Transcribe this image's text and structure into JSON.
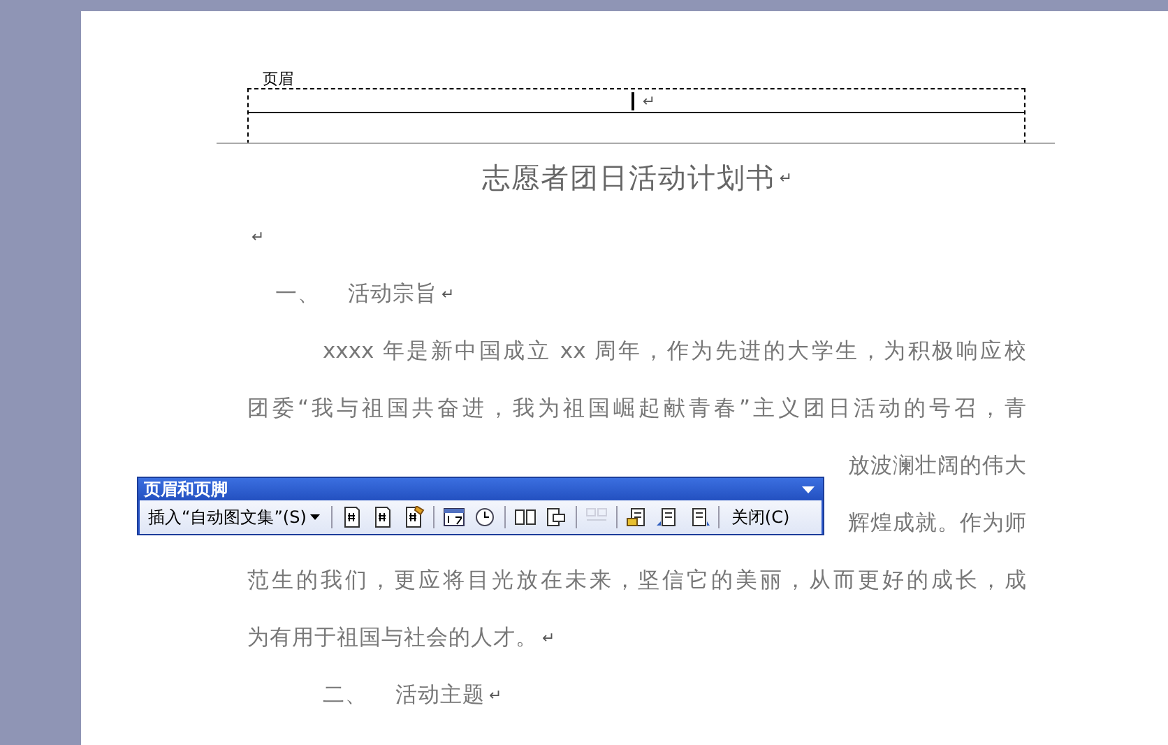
{
  "header": {
    "label": "页眉",
    "mark": "↵"
  },
  "title": {
    "text": "志愿者团日活动计划书",
    "mark": "↵"
  },
  "lines": [
    {
      "kind": "blank",
      "mark": "↵"
    },
    {
      "kind": "heading",
      "number": "一、",
      "text": "活动宗旨",
      "mark": "↵"
    },
    {
      "kind": "first_line",
      "text": "xxxx 年是新中国成立 xx 周年，作为先进的大学生，为积极响应校"
    },
    {
      "kind": "line",
      "text": "团委“我与祖国共奋进，我为祖国崛起献青春”主义团日活动的号召，青"
    },
    {
      "kind": "partial_line",
      "text": "放波澜壮阔的伟大"
    },
    {
      "kind": "partial_line",
      "text": "辉煌成就。作为师"
    },
    {
      "kind": "line",
      "text": "范生的我们，更应将目光放在未来，坚信它的美丽，从而更好的成长，成"
    },
    {
      "kind": "last_line",
      "text": "为有用于祖国与社会的人才。",
      "mark": "↵"
    },
    {
      "kind": "heading_indent",
      "number": "二、",
      "text": "活动主题",
      "mark": "↵"
    }
  ],
  "toolbar": {
    "title": "页眉和页脚",
    "items": [
      {
        "kind": "menu",
        "label": "插入“自动图文集”(S)"
      },
      {
        "kind": "sep"
      },
      {
        "kind": "icon",
        "disabled": false
      },
      {
        "kind": "icon",
        "disabled": false
      },
      {
        "kind": "icon",
        "disabled": false
      },
      {
        "kind": "sep"
      },
      {
        "kind": "icon",
        "disabled": false
      },
      {
        "kind": "icon",
        "disabled": false
      },
      {
        "kind": "sep"
      },
      {
        "kind": "icon",
        "disabled": false
      },
      {
        "kind": "icon",
        "disabled": false
      },
      {
        "kind": "sep"
      },
      {
        "kind": "icon",
        "disabled": true
      },
      {
        "kind": "sep"
      },
      {
        "kind": "icon",
        "disabled": false
      },
      {
        "kind": "icon",
        "disabled": false
      },
      {
        "kind": "icon",
        "disabled": false
      },
      {
        "kind": "sep"
      },
      {
        "kind": "button",
        "label": "关闭(C)"
      }
    ]
  }
}
